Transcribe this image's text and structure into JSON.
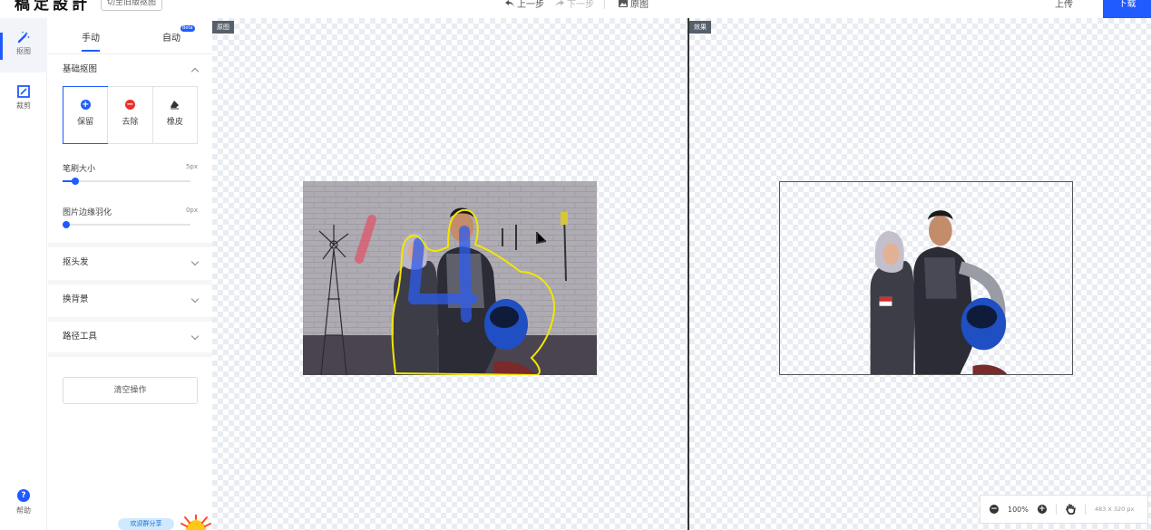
{
  "app": {
    "logo": "稿定設計",
    "switch_label": "切至旧版抠图"
  },
  "toolbar": {
    "undo_label": "上一步",
    "redo_label": "下一步",
    "original_label": "原图",
    "upload_label": "上传",
    "download_label": "下载"
  },
  "rail": {
    "items": [
      {
        "label": "抠图",
        "icon": "magic-wand-icon",
        "active": true
      },
      {
        "label": "裁剪",
        "icon": "crop-icon",
        "active": false
      }
    ],
    "help_label": "帮助"
  },
  "panel": {
    "tabs": [
      {
        "label": "手动",
        "active": true
      },
      {
        "label": "自动",
        "active": false,
        "badge": "Beta"
      }
    ],
    "basic_section": {
      "title": "基础抠图",
      "modes": [
        {
          "label": "保留",
          "icon": "plus-circle-icon",
          "color": "#1f5bff",
          "active": true
        },
        {
          "label": "去除",
          "icon": "minus-circle-icon",
          "color": "#e8312b",
          "active": false
        },
        {
          "label": "橡皮",
          "icon": "eraser-icon",
          "color": "#333333",
          "active": false
        }
      ],
      "brush_size": {
        "label": "笔刷大小",
        "value": "5px",
        "level": 0.1
      },
      "feather": {
        "label": "图片边缘羽化",
        "value": "0px",
        "level": 0.0
      }
    },
    "sections": [
      {
        "title": "抠头发"
      },
      {
        "title": "换背景"
      },
      {
        "title": "路径工具"
      }
    ],
    "clear_label": "清空操作",
    "promo_label": "欢迎群分享"
  },
  "canvas": {
    "left_tag": "原图",
    "right_tag": "效果"
  },
  "zoom": {
    "level": "100%",
    "image_size": "483 X 320 px"
  },
  "colors": {
    "accent": "#1f5bff",
    "remove": "#e8312b",
    "selection_outline": "#f2e600"
  }
}
